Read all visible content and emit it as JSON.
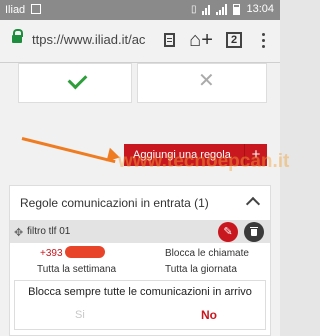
{
  "status_bar": {
    "carrier": "Iliad",
    "time": "13:04"
  },
  "browser": {
    "url": "ttps://www.iliad.it/ac",
    "tab_count": "2",
    "home_plus": "⌂+"
  },
  "toggle_cards": {
    "yes_icon": "checkmark-icon",
    "no_icon": "cross-icon",
    "no_glyph": "✕"
  },
  "watermark": "www.tecnoepcan.it",
  "add_rule_button": {
    "label": "Aggiungi una regola",
    "plus": "+"
  },
  "rules_panel": {
    "title": "Regole comunicazioni in entrata (1)",
    "rule": {
      "drag_glyph": "✥",
      "name": "filtro tlf 01",
      "edit_glyph": "✎",
      "phone_prefix": "+393",
      "action": "Blocca le chiamate",
      "period_left": "Tutta la settimana",
      "period_right": "Tutta la giornata"
    },
    "block_all": {
      "title": "Blocca sempre tutte le comunicazioni in arrivo",
      "option_yes": "Si",
      "option_no": "No"
    }
  },
  "colors": {
    "accent": "#c8171e",
    "check": "#2e9e3a",
    "arrow": "#f07c22"
  }
}
